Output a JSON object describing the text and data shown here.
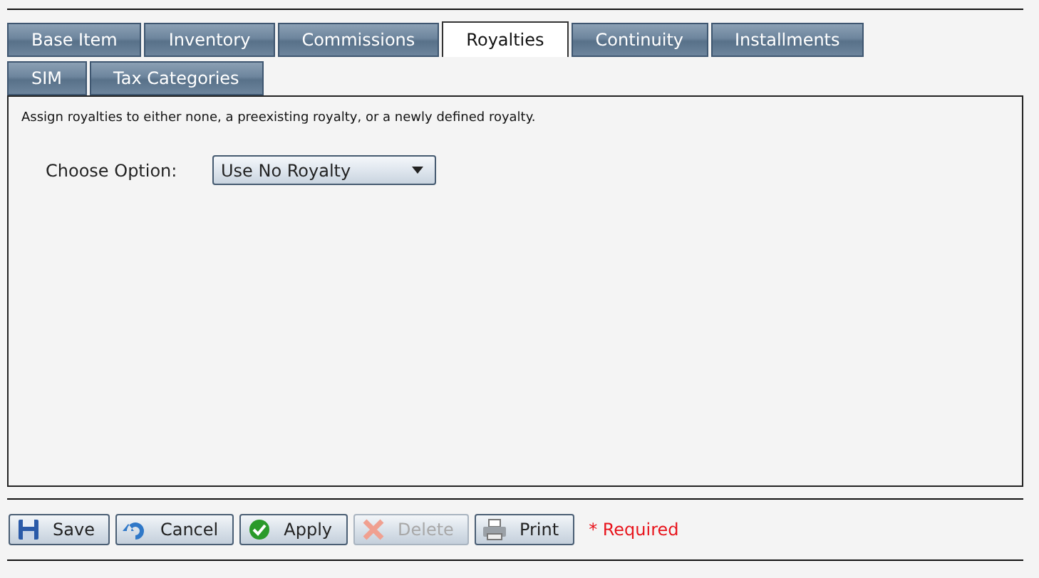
{
  "tabs": [
    {
      "label": "Base Item",
      "selected": false
    },
    {
      "label": "Inventory",
      "selected": false
    },
    {
      "label": "Commissions",
      "selected": false
    },
    {
      "label": "Royalties",
      "selected": true
    },
    {
      "label": "Continuity",
      "selected": false
    },
    {
      "label": "Installments",
      "selected": false
    },
    {
      "label": "SIM",
      "selected": false
    },
    {
      "label": "Tax Categories",
      "selected": false
    }
  ],
  "panel": {
    "description": "Assign royalties to either none, a preexisting royalty, or a newly defined royalty.",
    "option_label": "Choose Option:",
    "option_value": "Use No Royalty"
  },
  "buttons": [
    {
      "kind": "save",
      "label": "Save",
      "disabled": false
    },
    {
      "kind": "cancel",
      "label": "Cancel",
      "disabled": false
    },
    {
      "kind": "apply",
      "label": "Apply",
      "disabled": false
    },
    {
      "kind": "delete",
      "label": "Delete",
      "disabled": true
    },
    {
      "kind": "print",
      "label": "Print",
      "disabled": false
    }
  ],
  "required_note": "* Required"
}
